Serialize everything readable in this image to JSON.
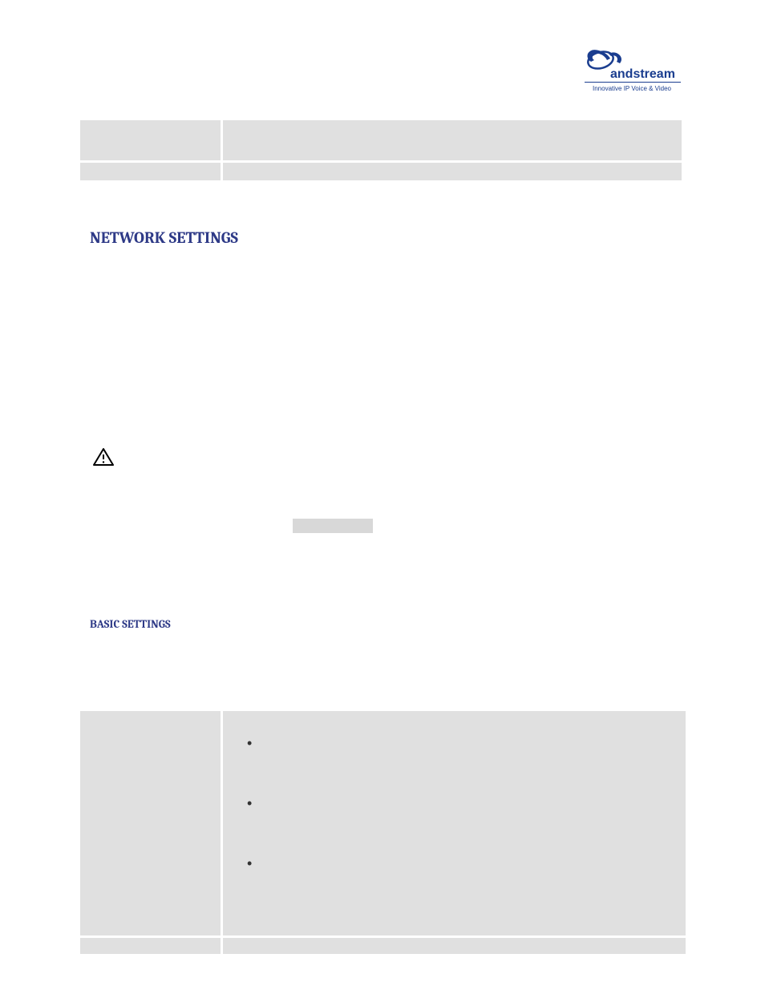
{
  "logo": {
    "brand_name": "Grandstream",
    "tagline": "Innovative IP Voice & Video"
  },
  "sections": {
    "network_settings": {
      "heading": "NETWORK SETTINGS"
    },
    "basic_settings": {
      "heading": "BASIC SETTINGS"
    }
  },
  "table_top": {
    "row1": {
      "label": "",
      "value": ""
    },
    "row2": {
      "label": "",
      "value": ""
    }
  },
  "table_bottom": {
    "row1": {
      "label": "",
      "bullets": [
        "",
        "",
        ""
      ]
    },
    "row2": {
      "label": "",
      "value": ""
    }
  }
}
